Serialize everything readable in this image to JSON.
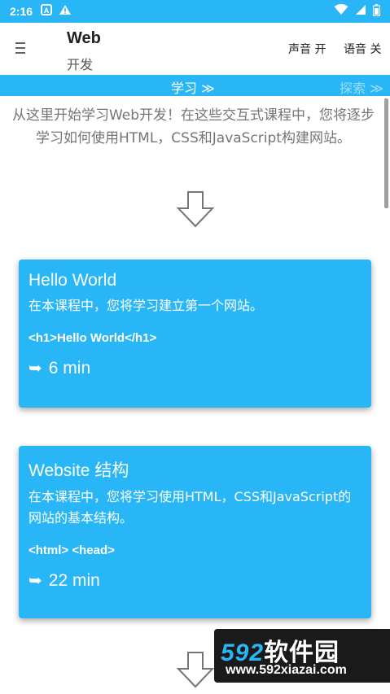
{
  "status": {
    "time": "2:16"
  },
  "app": {
    "title": "Web",
    "subtitle": "开发",
    "sound_toggle": "声音 开",
    "voice_toggle": "语音 关"
  },
  "tabs": {
    "learn": "学习 ≫",
    "explore": "探索 ≫"
  },
  "intro_text": "从这里开始学习Web开发！在这些交互式课程中，您将逐步学习如何使用HTML，CSS和JavaScript构建网站。",
  "lessons": [
    {
      "title": "Hello World",
      "description": "在本课程中，您将学习建立第一个网站。",
      "code": "<h1>Hello World</h1>",
      "duration": "6 min"
    },
    {
      "title": "Website 结构",
      "description": "在本课程中，您将学习使用HTML，CSS和JavaScript的网站的基本结构。",
      "code": "<html> <head>",
      "duration": "22 min"
    }
  ],
  "watermark": {
    "logo_num": "592",
    "logo_text": "软件园",
    "url": "www.592xiazai.com"
  },
  "colors": {
    "accent": "#29b6f6",
    "text_muted": "#757575"
  }
}
